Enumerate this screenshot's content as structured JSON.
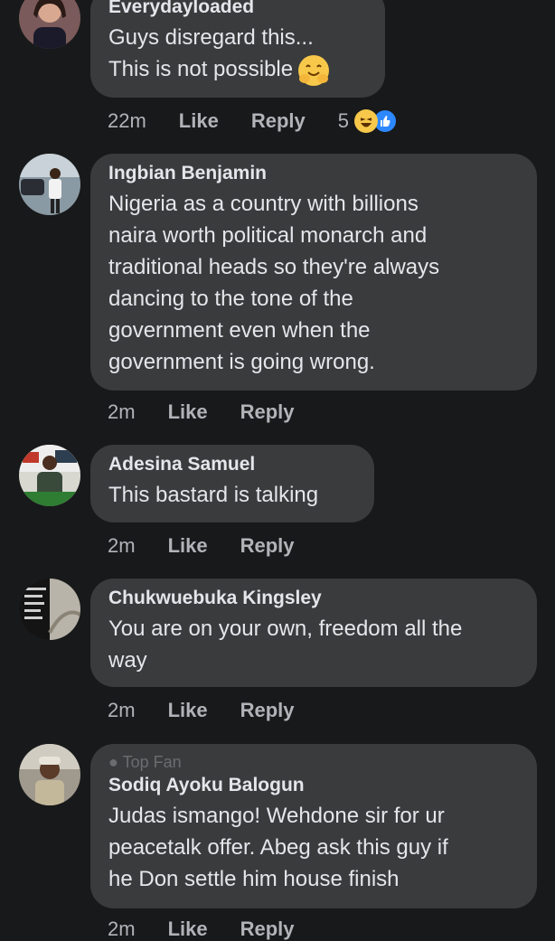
{
  "comments": [
    {
      "author": "Everydayloaded",
      "lines": [
        "Guys disregard this...",
        "This is not possible"
      ],
      "time": "22m",
      "like": "Like",
      "reply": "Reply",
      "reaction_count": "5",
      "reaction_icons": [
        "haha-icon",
        "like-icon"
      ],
      "inline_emoji": "smiling-face-with-hands-icon"
    },
    {
      "author": "Ingbian Benjamin",
      "lines": [
        "Nigeria as a country with billions",
        "naira worth political monarch and",
        "traditional heads so they're always",
        "dancing to the tone of the",
        "government even when the",
        "government is going wrong."
      ],
      "time": "2m",
      "like": "Like",
      "reply": "Reply"
    },
    {
      "author": "Adesina Samuel",
      "lines": [
        "This bastard is talking"
      ],
      "time": "2m",
      "like": "Like",
      "reply": "Reply"
    },
    {
      "author": "Chukwuebuka Kingsley",
      "lines": [
        "You are on your own, freedom all the",
        "way"
      ],
      "time": "2m",
      "like": "Like",
      "reply": "Reply"
    },
    {
      "author": "Sodiq Ayoku Balogun",
      "badge": "Top Fan",
      "lines": [
        "Judas ismango! Wehdone sir for ur",
        "peacetalk offer. Abeg ask this guy if",
        "he Don settle him house finish"
      ],
      "time": "2m",
      "like": "Like",
      "reply": "Reply"
    }
  ],
  "colors": {
    "background": "#18191a",
    "bubble": "#3a3b3c",
    "text": "#e4e6eb",
    "secondary": "#b0b3b8",
    "like_blue": "#2d88ff"
  }
}
